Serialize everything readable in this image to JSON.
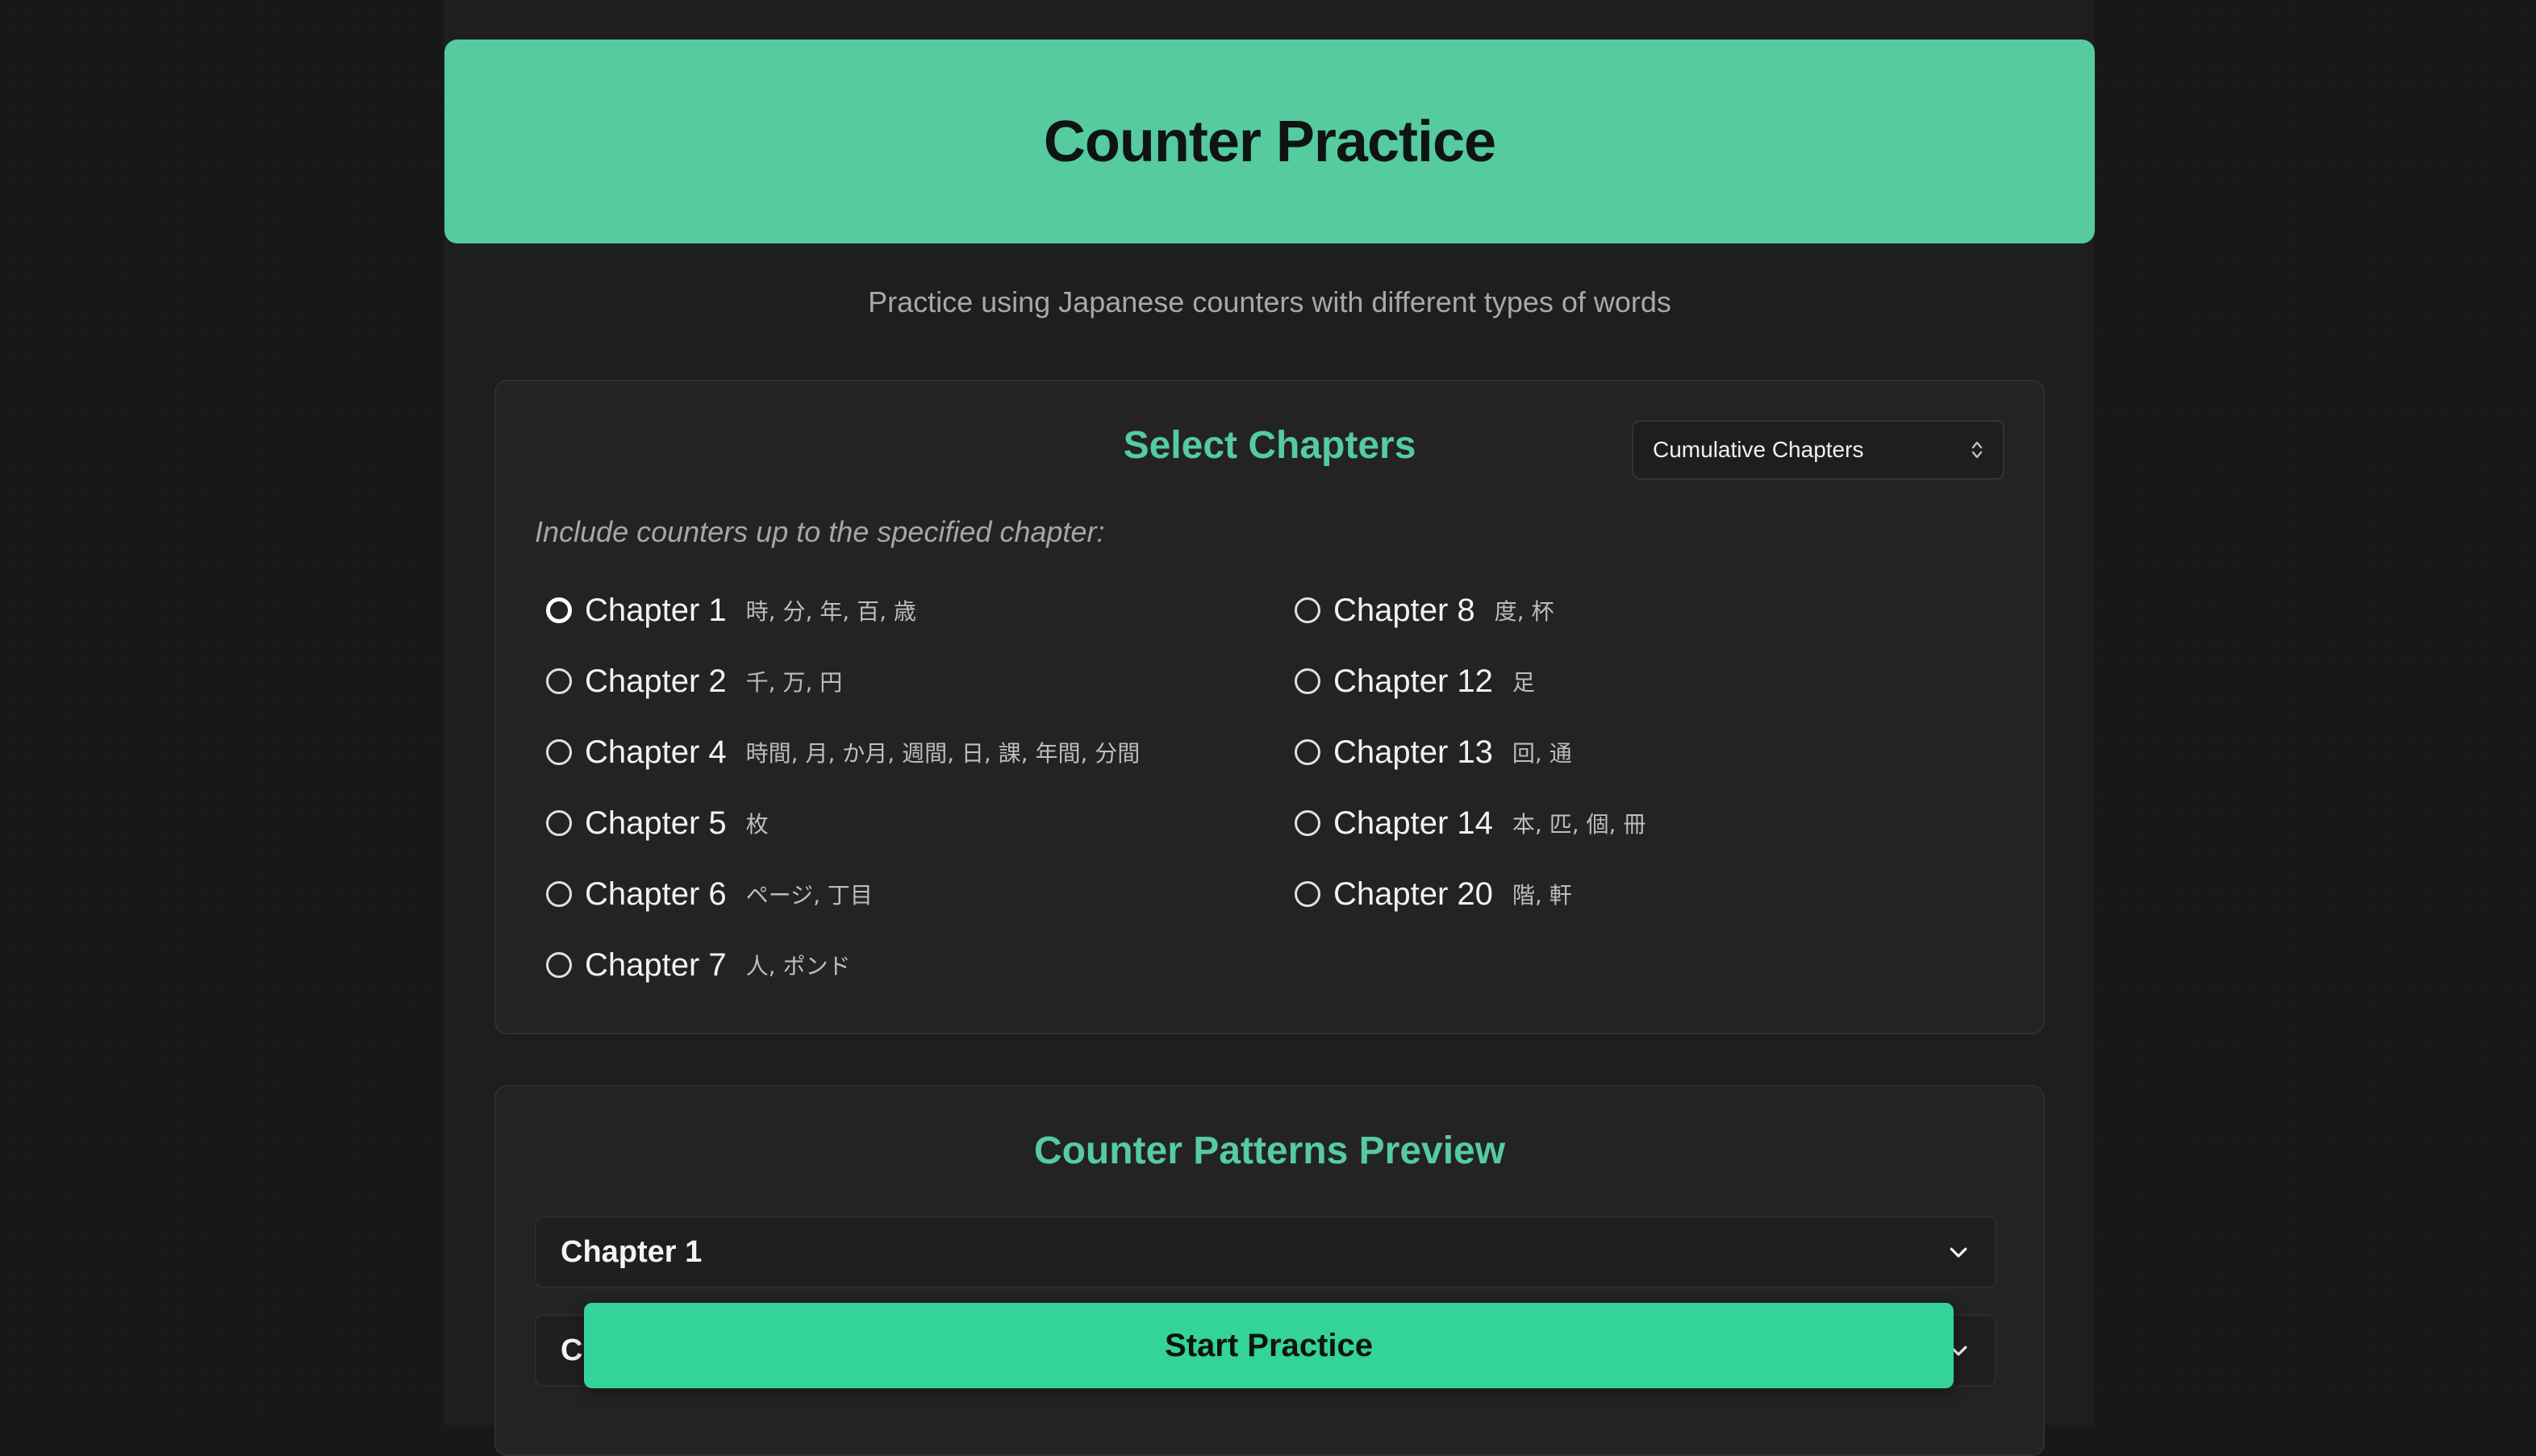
{
  "header": {
    "title": "Counter Practice"
  },
  "subtitle": "Practice using Japanese counters with different types of words",
  "chapter_select": {
    "title": "Select Chapters",
    "mode_selected": "Cumulative Chapters",
    "instruction": "Include counters up to the specified chapter:",
    "selected": "Chapter 1",
    "left_column": [
      {
        "name": "Chapter 1",
        "counters": "時, 分, 年, 百, 歳",
        "checked": true
      },
      {
        "name": "Chapter 2",
        "counters": "千, 万, 円",
        "checked": false
      },
      {
        "name": "Chapter 4",
        "counters": "時間, 月, か月, 週間, 日, 課, 年間, 分間",
        "checked": false
      },
      {
        "name": "Chapter 5",
        "counters": "枚",
        "checked": false
      },
      {
        "name": "Chapter 6",
        "counters": "ページ, 丁目",
        "checked": false
      },
      {
        "name": "Chapter 7",
        "counters": "人, ポンド",
        "checked": false
      }
    ],
    "right_column": [
      {
        "name": "Chapter 8",
        "counters": "度, 杯",
        "checked": false
      },
      {
        "name": "Chapter 12",
        "counters": "足",
        "checked": false
      },
      {
        "name": "Chapter 13",
        "counters": "回, 通",
        "checked": false
      },
      {
        "name": "Chapter 14",
        "counters": "本, 匹, 個, 冊",
        "checked": false
      },
      {
        "name": "Chapter 20",
        "counters": "階, 軒",
        "checked": false
      }
    ]
  },
  "preview": {
    "title": "Counter Patterns Preview",
    "accordions": [
      {
        "label": "Chapter 1"
      },
      {
        "label": "C"
      }
    ]
  },
  "start_button": {
    "label": "Start Practice"
  },
  "colors": {
    "accent": "#55cb9f",
    "button": "#34d399",
    "background": "#181818",
    "card": "#232323"
  }
}
